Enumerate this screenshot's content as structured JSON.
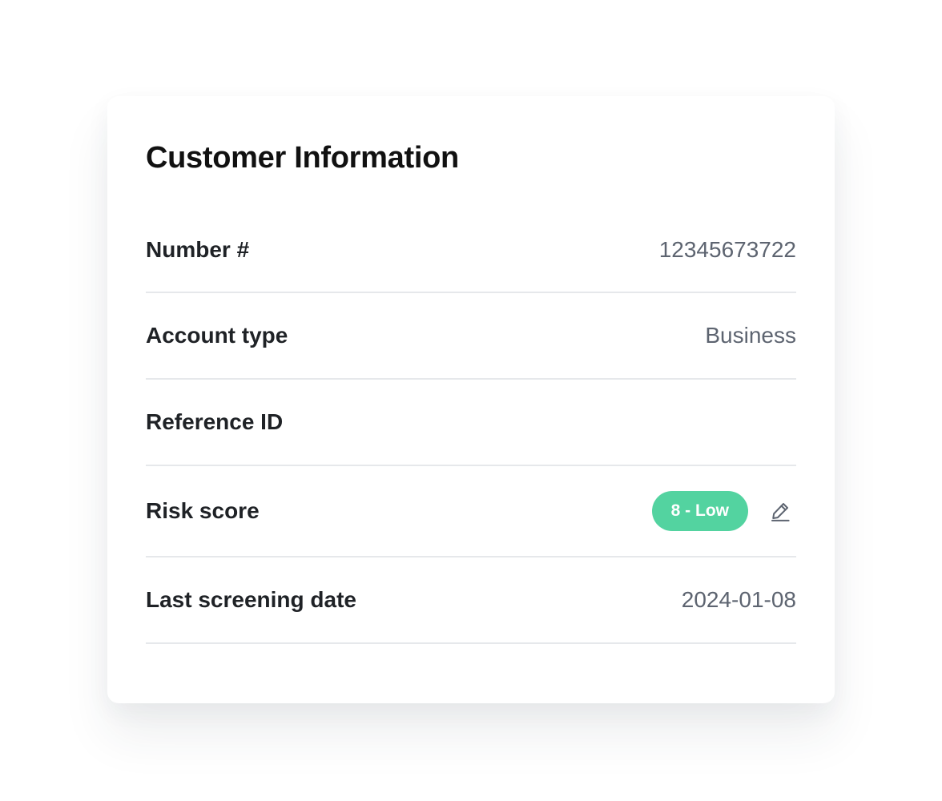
{
  "card": {
    "title": "Customer Information"
  },
  "rows": [
    {
      "label": "Number #",
      "value": "12345673722"
    },
    {
      "label": "Account type",
      "value": "Business"
    },
    {
      "label": "Reference ID",
      "value": ""
    },
    {
      "label": "Risk score",
      "badge": "8 - Low",
      "badge_color": "#53d3a0",
      "action_icon": "pencil-edit-icon"
    },
    {
      "label": "Last screening date",
      "value": "2024-01-08"
    }
  ]
}
